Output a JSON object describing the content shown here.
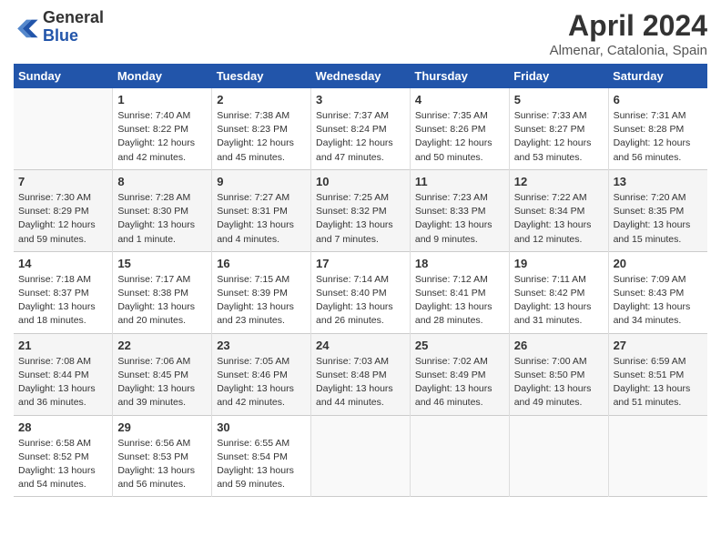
{
  "header": {
    "logo_general": "General",
    "logo_blue": "Blue",
    "month": "April 2024",
    "location": "Almenar, Catalonia, Spain"
  },
  "calendar": {
    "days_of_week": [
      "Sunday",
      "Monday",
      "Tuesday",
      "Wednesday",
      "Thursday",
      "Friday",
      "Saturday"
    ],
    "weeks": [
      [
        {
          "day": "",
          "info": ""
        },
        {
          "day": "1",
          "info": "Sunrise: 7:40 AM\nSunset: 8:22 PM\nDaylight: 12 hours\nand 42 minutes."
        },
        {
          "day": "2",
          "info": "Sunrise: 7:38 AM\nSunset: 8:23 PM\nDaylight: 12 hours\nand 45 minutes."
        },
        {
          "day": "3",
          "info": "Sunrise: 7:37 AM\nSunset: 8:24 PM\nDaylight: 12 hours\nand 47 minutes."
        },
        {
          "day": "4",
          "info": "Sunrise: 7:35 AM\nSunset: 8:26 PM\nDaylight: 12 hours\nand 50 minutes."
        },
        {
          "day": "5",
          "info": "Sunrise: 7:33 AM\nSunset: 8:27 PM\nDaylight: 12 hours\nand 53 minutes."
        },
        {
          "day": "6",
          "info": "Sunrise: 7:31 AM\nSunset: 8:28 PM\nDaylight: 12 hours\nand 56 minutes."
        }
      ],
      [
        {
          "day": "7",
          "info": "Sunrise: 7:30 AM\nSunset: 8:29 PM\nDaylight: 12 hours\nand 59 minutes."
        },
        {
          "day": "8",
          "info": "Sunrise: 7:28 AM\nSunset: 8:30 PM\nDaylight: 13 hours\nand 1 minute."
        },
        {
          "day": "9",
          "info": "Sunrise: 7:27 AM\nSunset: 8:31 PM\nDaylight: 13 hours\nand 4 minutes."
        },
        {
          "day": "10",
          "info": "Sunrise: 7:25 AM\nSunset: 8:32 PM\nDaylight: 13 hours\nand 7 minutes."
        },
        {
          "day": "11",
          "info": "Sunrise: 7:23 AM\nSunset: 8:33 PM\nDaylight: 13 hours\nand 9 minutes."
        },
        {
          "day": "12",
          "info": "Sunrise: 7:22 AM\nSunset: 8:34 PM\nDaylight: 13 hours\nand 12 minutes."
        },
        {
          "day": "13",
          "info": "Sunrise: 7:20 AM\nSunset: 8:35 PM\nDaylight: 13 hours\nand 15 minutes."
        }
      ],
      [
        {
          "day": "14",
          "info": "Sunrise: 7:18 AM\nSunset: 8:37 PM\nDaylight: 13 hours\nand 18 minutes."
        },
        {
          "day": "15",
          "info": "Sunrise: 7:17 AM\nSunset: 8:38 PM\nDaylight: 13 hours\nand 20 minutes."
        },
        {
          "day": "16",
          "info": "Sunrise: 7:15 AM\nSunset: 8:39 PM\nDaylight: 13 hours\nand 23 minutes."
        },
        {
          "day": "17",
          "info": "Sunrise: 7:14 AM\nSunset: 8:40 PM\nDaylight: 13 hours\nand 26 minutes."
        },
        {
          "day": "18",
          "info": "Sunrise: 7:12 AM\nSunset: 8:41 PM\nDaylight: 13 hours\nand 28 minutes."
        },
        {
          "day": "19",
          "info": "Sunrise: 7:11 AM\nSunset: 8:42 PM\nDaylight: 13 hours\nand 31 minutes."
        },
        {
          "day": "20",
          "info": "Sunrise: 7:09 AM\nSunset: 8:43 PM\nDaylight: 13 hours\nand 34 minutes."
        }
      ],
      [
        {
          "day": "21",
          "info": "Sunrise: 7:08 AM\nSunset: 8:44 PM\nDaylight: 13 hours\nand 36 minutes."
        },
        {
          "day": "22",
          "info": "Sunrise: 7:06 AM\nSunset: 8:45 PM\nDaylight: 13 hours\nand 39 minutes."
        },
        {
          "day": "23",
          "info": "Sunrise: 7:05 AM\nSunset: 8:46 PM\nDaylight: 13 hours\nand 42 minutes."
        },
        {
          "day": "24",
          "info": "Sunrise: 7:03 AM\nSunset: 8:48 PM\nDaylight: 13 hours\nand 44 minutes."
        },
        {
          "day": "25",
          "info": "Sunrise: 7:02 AM\nSunset: 8:49 PM\nDaylight: 13 hours\nand 46 minutes."
        },
        {
          "day": "26",
          "info": "Sunrise: 7:00 AM\nSunset: 8:50 PM\nDaylight: 13 hours\nand 49 minutes."
        },
        {
          "day": "27",
          "info": "Sunrise: 6:59 AM\nSunset: 8:51 PM\nDaylight: 13 hours\nand 51 minutes."
        }
      ],
      [
        {
          "day": "28",
          "info": "Sunrise: 6:58 AM\nSunset: 8:52 PM\nDaylight: 13 hours\nand 54 minutes."
        },
        {
          "day": "29",
          "info": "Sunrise: 6:56 AM\nSunset: 8:53 PM\nDaylight: 13 hours\nand 56 minutes."
        },
        {
          "day": "30",
          "info": "Sunrise: 6:55 AM\nSunset: 8:54 PM\nDaylight: 13 hours\nand 59 minutes."
        },
        {
          "day": "",
          "info": ""
        },
        {
          "day": "",
          "info": ""
        },
        {
          "day": "",
          "info": ""
        },
        {
          "day": "",
          "info": ""
        }
      ]
    ]
  }
}
